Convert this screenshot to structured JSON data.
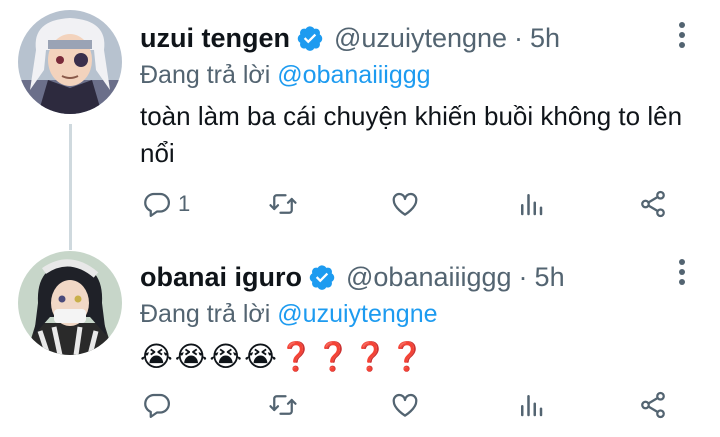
{
  "tweets": [
    {
      "name": "uzui tengen",
      "handle": "@uzuiytengne",
      "separator": "·",
      "time": "5h",
      "reply_prefix": "Đang trả lời",
      "reply_to": "@obanaiiiggg",
      "text": "toàn làm ba cái chuyện khiến buồi không to lên nổi",
      "reply_count": "1",
      "avatar_icon": "anime-character-avatar-white-hair",
      "verified_icon": "verified-badge-icon"
    },
    {
      "name": "obanai iguro",
      "handle": "@obanaiiiggg",
      "separator": "·",
      "time": "5h",
      "reply_prefix": "Đang trả lời",
      "reply_to": "@uzuiytengne",
      "text": "😭😭😭😭❓❓❓❓",
      "reply_count": "",
      "avatar_icon": "anime-character-avatar-black-hair",
      "verified_icon": "verified-badge-icon"
    }
  ],
  "colors": {
    "accent": "#1d9bf0",
    "secondary_text": "#536471",
    "primary_text": "#0f1419",
    "thread_line": "#cfd9de"
  },
  "action_icons": [
    "reply-icon",
    "retweet-icon",
    "like-icon",
    "stats-icon",
    "share-icon"
  ]
}
